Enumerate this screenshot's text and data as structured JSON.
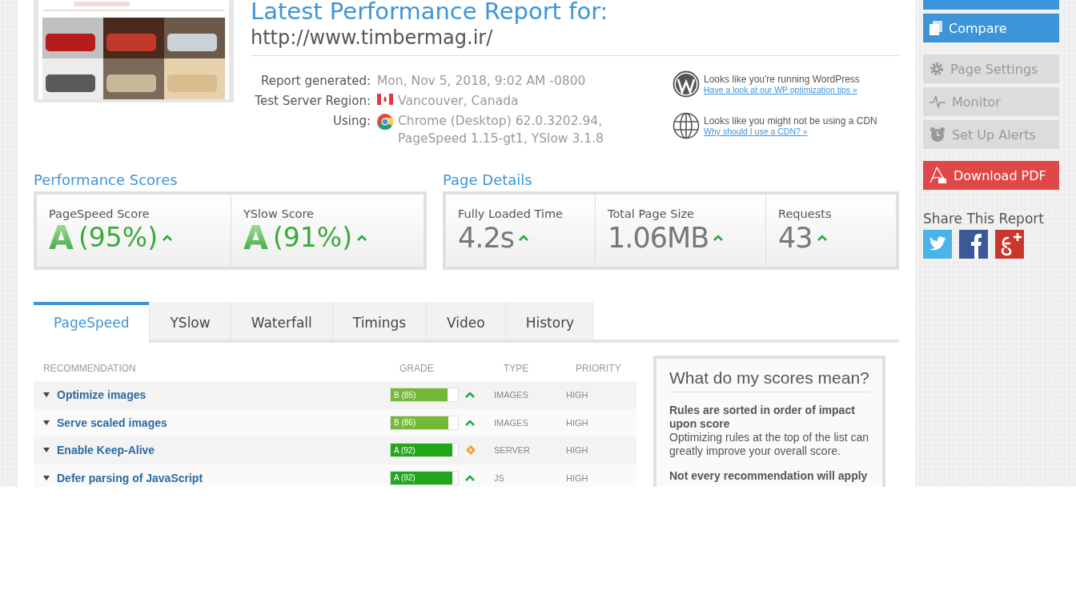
{
  "header": {
    "title": "Latest Performance Report for:",
    "url": "http://www.timbermag.ir/",
    "details": [
      {
        "label": "Report generated:",
        "value": "Mon, Nov 5, 2018, 9:02 AM -0800"
      },
      {
        "label": "Test Server Region:",
        "kind": "flag",
        "value": "Vancouver, Canada"
      },
      {
        "label": "Using:",
        "kind": "browser",
        "value": "Chrome (Desktop) 62.0.3202.94,",
        "value_2": "PageSpeed 1.15-gt1, YSlow 3.1.8"
      }
    ],
    "notices": [
      {
        "kind": "wordpress",
        "text": "Looks like you're running WordPress",
        "link": "Have a look at our WP optimization tips »"
      },
      {
        "kind": "cdn",
        "text": "Looks like you might not be using a CDN",
        "link": "Why should I use a CDN? »"
      }
    ]
  },
  "performance_scores": {
    "title": "Performance Scores",
    "items": [
      {
        "label": "PageSpeed Score",
        "grade": "A",
        "value": "(95%)"
      },
      {
        "label": "YSlow Score",
        "grade": "A",
        "value": "(91%)"
      }
    ]
  },
  "page_details": {
    "title": "Page Details",
    "items": [
      {
        "label": "Fully Loaded Time",
        "value": "4.2s"
      },
      {
        "label": "Total Page Size",
        "value": "1.06MB"
      },
      {
        "label": "Requests",
        "value": "43"
      }
    ]
  },
  "tabs": [
    {
      "label": "PageSpeed",
      "selected": true
    },
    {
      "label": "YSlow",
      "selected": false
    },
    {
      "label": "Waterfall",
      "selected": false
    },
    {
      "label": "Timings",
      "selected": false
    },
    {
      "label": "Video",
      "selected": false
    },
    {
      "label": "History",
      "selected": false
    }
  ],
  "recommendations": {
    "columns": [
      "RECOMMENDATION",
      "GRADE",
      "TYPE",
      "PRIORITY"
    ],
    "rows": [
      {
        "name": "Optimize images",
        "grade": "B (85)",
        "level": 0.85,
        "color": "#74b935",
        "kind": "up",
        "type": "IMAGES",
        "priority": "HIGH"
      },
      {
        "name": "Serve scaled images",
        "grade": "B (86)",
        "level": 0.86,
        "color": "#74b935",
        "kind": "up",
        "type": "IMAGES",
        "priority": "HIGH"
      },
      {
        "name": "Enable Keep-Alive",
        "grade": "A (92)",
        "level": 0.92,
        "color": "#22a61c",
        "kind": "same",
        "type": "SERVER",
        "priority": "HIGH"
      },
      {
        "name": "Defer parsing of JavaScript",
        "grade": "A (92)",
        "level": 0.92,
        "color": "#22a61c",
        "kind": "up",
        "type": "JS",
        "priority": "HIGH"
      }
    ]
  },
  "scores_help": {
    "title": "What do my scores mean?",
    "paragraphs": [
      {
        "heading": "Rules are sorted in order of impact upon score",
        "text": "Optimizing rules at the top of the list can greatly improve your overall score."
      },
      {
        "heading": "Not every recommendation will apply"
      }
    ]
  },
  "sidebar": {
    "buttons": [
      {
        "kind": "retest"
      },
      {
        "kind": "compare",
        "label": "Compare"
      },
      {
        "kind": "settings",
        "label": "Page Settings"
      },
      {
        "kind": "monitor",
        "label": "Monitor"
      },
      {
        "kind": "alerts",
        "label": "Set Up Alerts"
      },
      {
        "kind": "pdf",
        "label": "Download PDF"
      }
    ],
    "share_title": "Share This Report",
    "share": [
      {
        "kind": "twitter"
      },
      {
        "kind": "facebook"
      },
      {
        "kind": "googleplus"
      }
    ]
  }
}
